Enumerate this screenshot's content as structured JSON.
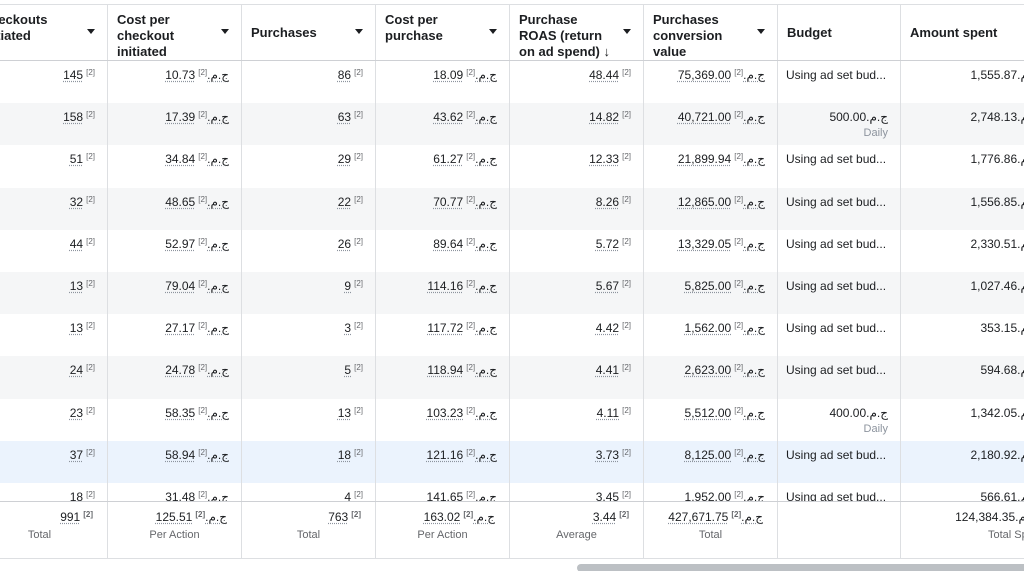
{
  "columns": [
    {
      "label": "Checkouts initiated",
      "sort": true
    },
    {
      "label": "Cost per checkout initiated",
      "sort": true
    },
    {
      "label": "Purchases",
      "sort": true
    },
    {
      "label": "Cost per purchase",
      "sort": true
    },
    {
      "label": "Purchase ROAS (return on ad spend) ↓",
      "sort": true
    },
    {
      "label": "Purchases conversion value",
      "sort": true
    },
    {
      "label": "Budget",
      "sort": false
    },
    {
      "label": "Amount spent",
      "sort": false
    }
  ],
  "footnote": "[2]",
  "rows": [
    {
      "checkouts": "145",
      "cost_checkout": "10.73ج.م.‏",
      "purchases": "86",
      "cost_purchase": "18.09ج.م.‏",
      "roas": "48.44",
      "conv_value": "75,369.00ج.م.‏",
      "budget": "Using ad set bud...",
      "budget_sub": "",
      "spent": "1,555.87ج.م.‏"
    },
    {
      "checkouts": "158",
      "cost_checkout": "17.39ج.م.‏",
      "purchases": "63",
      "cost_purchase": "43.62ج.م.‏",
      "roas": "14.82",
      "conv_value": "40,721.00ج.م.‏",
      "budget": "500.00ج.م.‏",
      "budget_sub": "Daily",
      "spent": "2,748.13ج.م.‏"
    },
    {
      "checkouts": "51",
      "cost_checkout": "34.84ج.م.‏",
      "purchases": "29",
      "cost_purchase": "61.27ج.م.‏",
      "roas": "12.33",
      "conv_value": "21,899.94ج.م.‏",
      "budget": "Using ad set bud...",
      "budget_sub": "",
      "spent": "1,776.86ج.م.‏"
    },
    {
      "checkouts": "32",
      "cost_checkout": "48.65ج.م.‏",
      "purchases": "22",
      "cost_purchase": "70.77ج.م.‏",
      "roas": "8.26",
      "conv_value": "12,865.00ج.م.‏",
      "budget": "Using ad set bud...",
      "budget_sub": "",
      "spent": "1,556.85ج.م.‏"
    },
    {
      "checkouts": "44",
      "cost_checkout": "52.97ج.م.‏",
      "purchases": "26",
      "cost_purchase": "89.64ج.م.‏",
      "roas": "5.72",
      "conv_value": "13,329.05ج.م.‏",
      "budget": "Using ad set bud...",
      "budget_sub": "",
      "spent": "2,330.51ج.م.‏"
    },
    {
      "checkouts": "13",
      "cost_checkout": "79.04ج.م.‏",
      "purchases": "9",
      "cost_purchase": "114.16ج.م.‏",
      "roas": "5.67",
      "conv_value": "5,825.00ج.م.‏",
      "budget": "Using ad set bud...",
      "budget_sub": "",
      "spent": "1,027.46ج.م.‏"
    },
    {
      "checkouts": "13",
      "cost_checkout": "27.17ج.م.‏",
      "purchases": "3",
      "cost_purchase": "117.72ج.م.‏",
      "roas": "4.42",
      "conv_value": "1,562.00ج.م.‏",
      "budget": "Using ad set bud...",
      "budget_sub": "",
      "spent": "353.15ج.م.‏"
    },
    {
      "checkouts": "24",
      "cost_checkout": "24.78ج.م.‏",
      "purchases": "5",
      "cost_purchase": "118.94ج.م.‏",
      "roas": "4.41",
      "conv_value": "2,623.00ج.م.‏",
      "budget": "Using ad set bud...",
      "budget_sub": "",
      "spent": "594.68ج.م.‏"
    },
    {
      "checkouts": "23",
      "cost_checkout": "58.35ج.م.‏",
      "purchases": "13",
      "cost_purchase": "103.23ج.م.‏",
      "roas": "4.11",
      "conv_value": "5,512.00ج.م.‏",
      "budget": "400.00ج.م.‏",
      "budget_sub": "Daily",
      "spent": "1,342.05ج.م.‏"
    },
    {
      "checkouts": "37",
      "cost_checkout": "58.94ج.م.‏",
      "purchases": "18",
      "cost_purchase": "121.16ج.م.‏",
      "roas": "3.73",
      "conv_value": "8,125.00ج.م.‏",
      "budget": "Using ad set bud...",
      "budget_sub": "",
      "spent": "2,180.92ج.م.‏"
    },
    {
      "checkouts": "18",
      "cost_checkout": "31.48ج.م.‏",
      "purchases": "4",
      "cost_purchase": "141.65ج.م.‏",
      "roas": "3.45",
      "conv_value": "1,952.00ج.م.‏",
      "budget": "Using ad set bud...",
      "budget_sub": "",
      "spent": "566.61ج.م.‏"
    }
  ],
  "totals": {
    "checkouts": "991",
    "checkouts_label": "Total",
    "cost_checkout": "125.51ج.م.‏",
    "cost_checkout_label": "Per Action",
    "purchases": "763",
    "purchases_label": "Total",
    "cost_purchase": "163.02ج.م.‏",
    "cost_purchase_label": "Per Action",
    "roas": "3.44",
    "roas_label": "Average",
    "conv_value": "427,671.75ج.م.‏",
    "conv_value_label": "Total",
    "spent": "124,384.35ج.م.‏",
    "spent_label": "Total Spent"
  },
  "highlight_row": 9
}
